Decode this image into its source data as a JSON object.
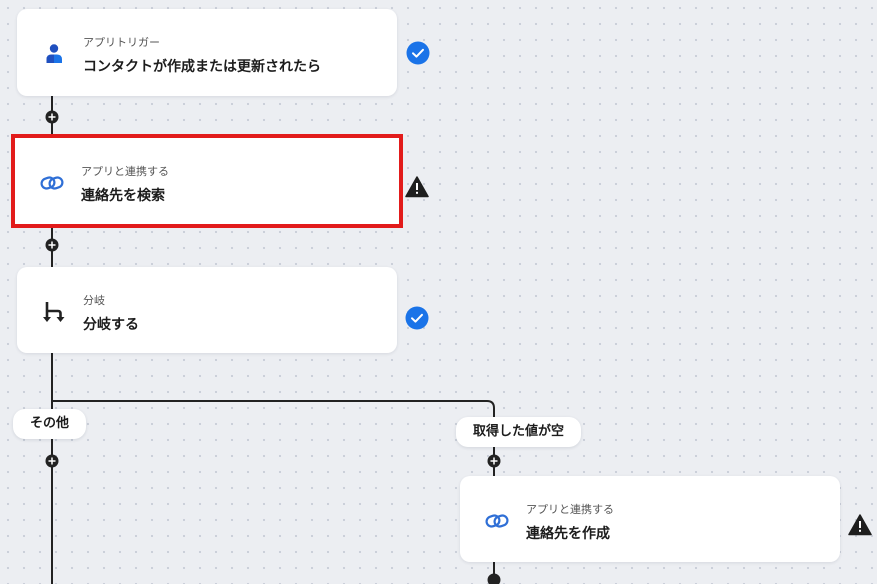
{
  "flow": {
    "steps": [
      {
        "type_label": "アプリトリガー",
        "title": "コンタクトが作成または更新されたら",
        "icon": "person-icon",
        "status": "complete"
      },
      {
        "type_label": "アプリと連携する",
        "title": "連絡先を検索",
        "icon": "app-link-icon",
        "status": "warning"
      },
      {
        "type_label": "分岐",
        "title": "分岐する",
        "icon": "branch-icon",
        "status": "complete"
      },
      {
        "type_label": "アプリと連携する",
        "title": "連絡先を作成",
        "icon": "app-link-icon",
        "status": "warning"
      }
    ],
    "branches": [
      {
        "label": "その他"
      },
      {
        "label": "取得した値が空"
      }
    ]
  },
  "colors": {
    "accent_blue": "#1a73e8",
    "warning_dark": "#1e1e1e",
    "selection_red": "#e21b1b",
    "connector": "#222222"
  }
}
